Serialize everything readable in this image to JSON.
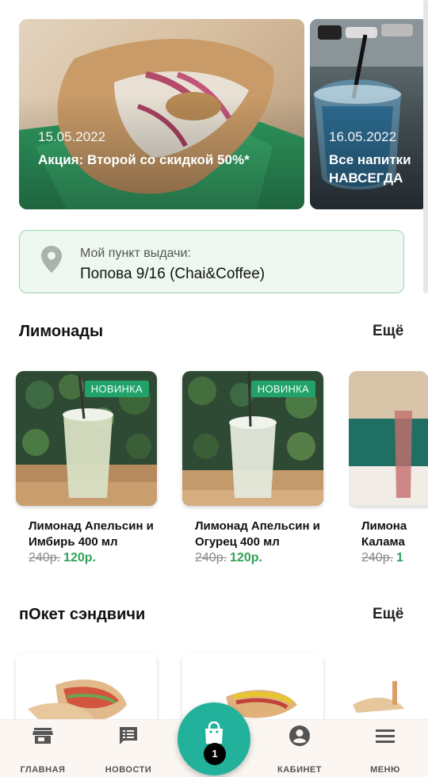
{
  "promos": [
    {
      "date": "15.05.2022",
      "title": "Акция: Второй со скидкой 50%*"
    },
    {
      "date": "16.05.2022",
      "title_line1": "Все напитки",
      "title_line2": "НАВСЕГДА"
    }
  ],
  "pickup": {
    "label": "Мой пункт выдачи:",
    "value": "Попова 9/16 (Chai&Coffee)"
  },
  "sections": [
    {
      "title": "Лимонады",
      "more": "Ещё",
      "items": [
        {
          "name_line1": "Лимонад Апельсин и",
          "name_line2": "Имбирь 400 мл",
          "old_price": "240р.",
          "price": "120р.",
          "badge": "НОВИНКА"
        },
        {
          "name_line1": "Лимонад Апельсин и",
          "name_line2": "Огурец 400 мл",
          "old_price": "240р.",
          "price": "120р.",
          "badge": "НОВИНКА"
        },
        {
          "name_line1": "Лимона",
          "name_line2": "Калама",
          "old_price": "240р.",
          "price": "1"
        }
      ]
    },
    {
      "title": "пОкет сэндвичи",
      "more": "Ещё"
    }
  ],
  "nav": {
    "home": "ГЛАВНАЯ",
    "news": "НОВОСТИ",
    "cabinet": "КАБИНЕТ",
    "menu": "МЕНЮ",
    "cart_count": "1"
  },
  "colors": {
    "accent": "#22b29b",
    "badge": "#22a26b",
    "price": "#2fa257"
  },
  "icons": [
    "map-pin-icon",
    "store-icon",
    "news-icon",
    "shopping-bag-icon",
    "account-icon",
    "menu-icon"
  ]
}
